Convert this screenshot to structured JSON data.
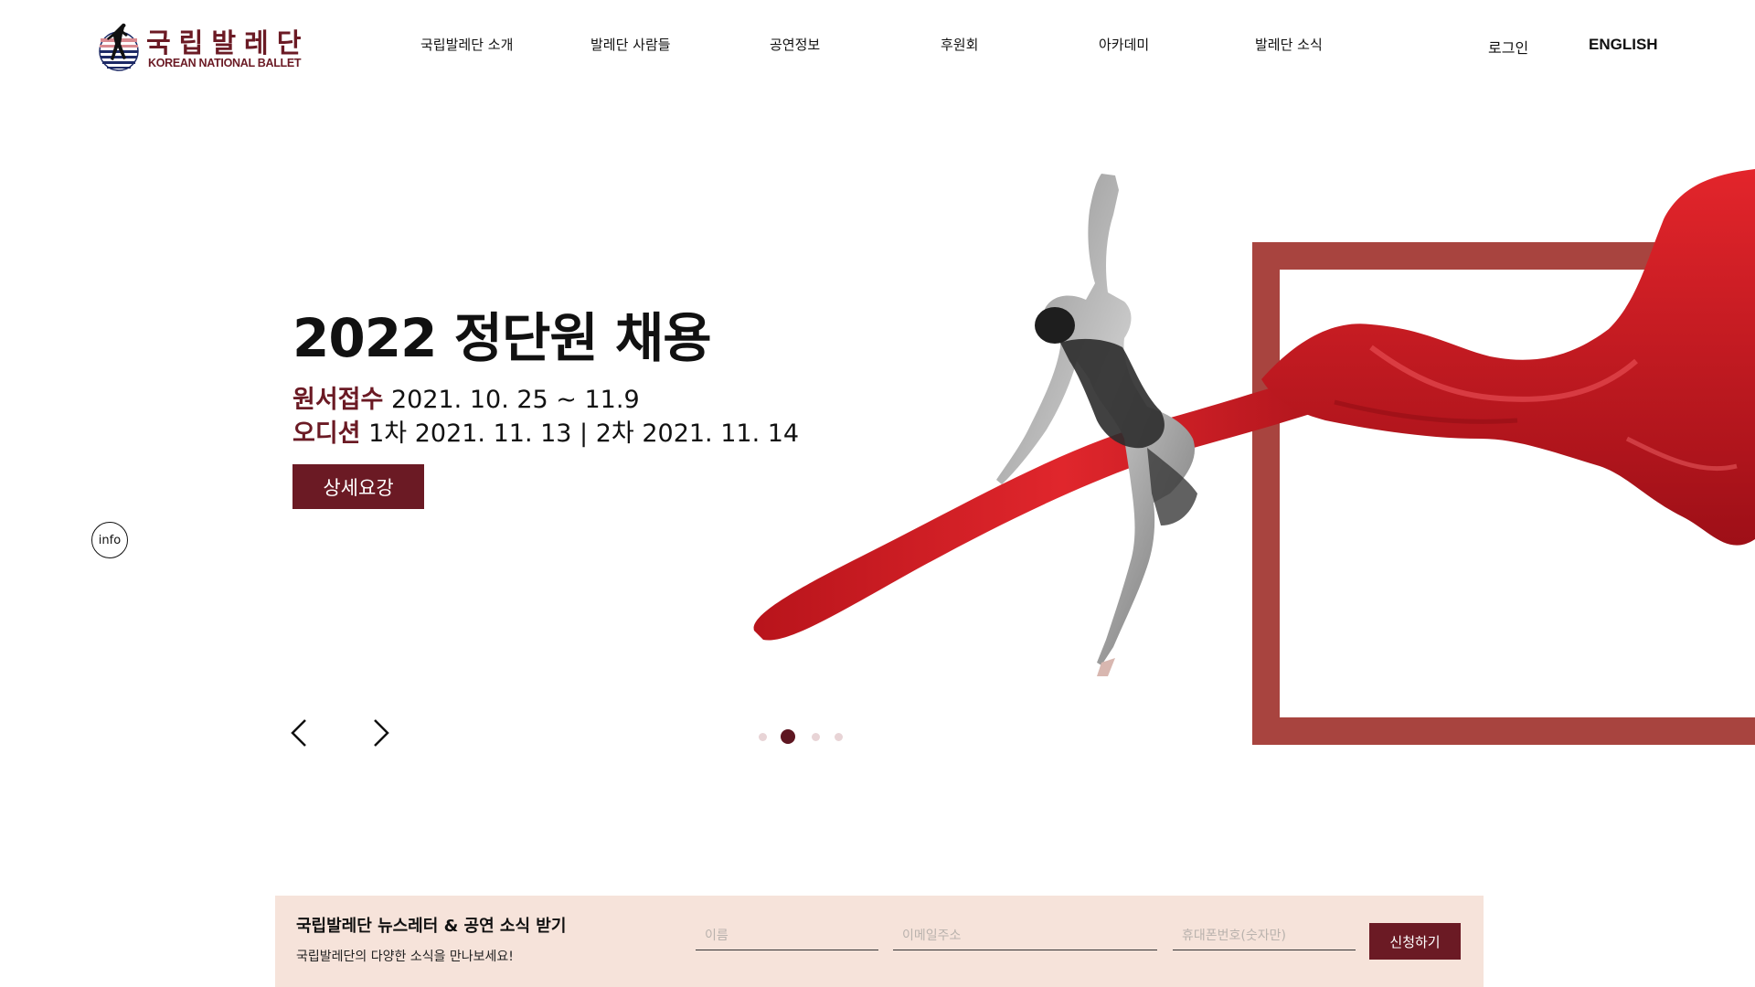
{
  "header": {
    "logo": {
      "korean": "국립발레단",
      "english": "KOREAN NATIONAL BALLET"
    },
    "nav": [
      {
        "label": "국립발레단 소개"
      },
      {
        "label": "발레단 사람들"
      },
      {
        "label": "공연정보"
      },
      {
        "label": "후원회"
      },
      {
        "label": "아카데미"
      },
      {
        "label": "발레단 소식"
      }
    ],
    "login_label": "로그인",
    "english_label": "ENGLISH"
  },
  "hero": {
    "title": "2022 정단원 채용",
    "line1": {
      "label": "원서접수",
      "value": " 2021. 10. 25 ~ 11.9"
    },
    "line2": {
      "label": "오디션",
      "value": " 1차 2021. 11. 13 | 2차 2021. 11. 14"
    },
    "detail_button": "상세요강",
    "info_button": "info",
    "slider": {
      "total": 4,
      "active_index": 1
    },
    "icons": {
      "prev": "chevron-left-icon",
      "next": "chevron-right-icon"
    }
  },
  "newsletter": {
    "title": "국립발레단 뉴스레터 & 공연 소식 받기",
    "subtitle": "국립발레단의 다양한 소식을 만나보세요!",
    "name_placeholder": "이름",
    "email_placeholder": "이메일주소",
    "phone_placeholder": "휴대폰번호(숫자만)",
    "submit_label": "신청하기"
  },
  "colors": {
    "brand": "#6b1a24",
    "frame": "#a8443f",
    "silk": "#d41e24",
    "newsletter_bg": "#f6e3da",
    "dot_inactive": "#e8d4d6"
  }
}
